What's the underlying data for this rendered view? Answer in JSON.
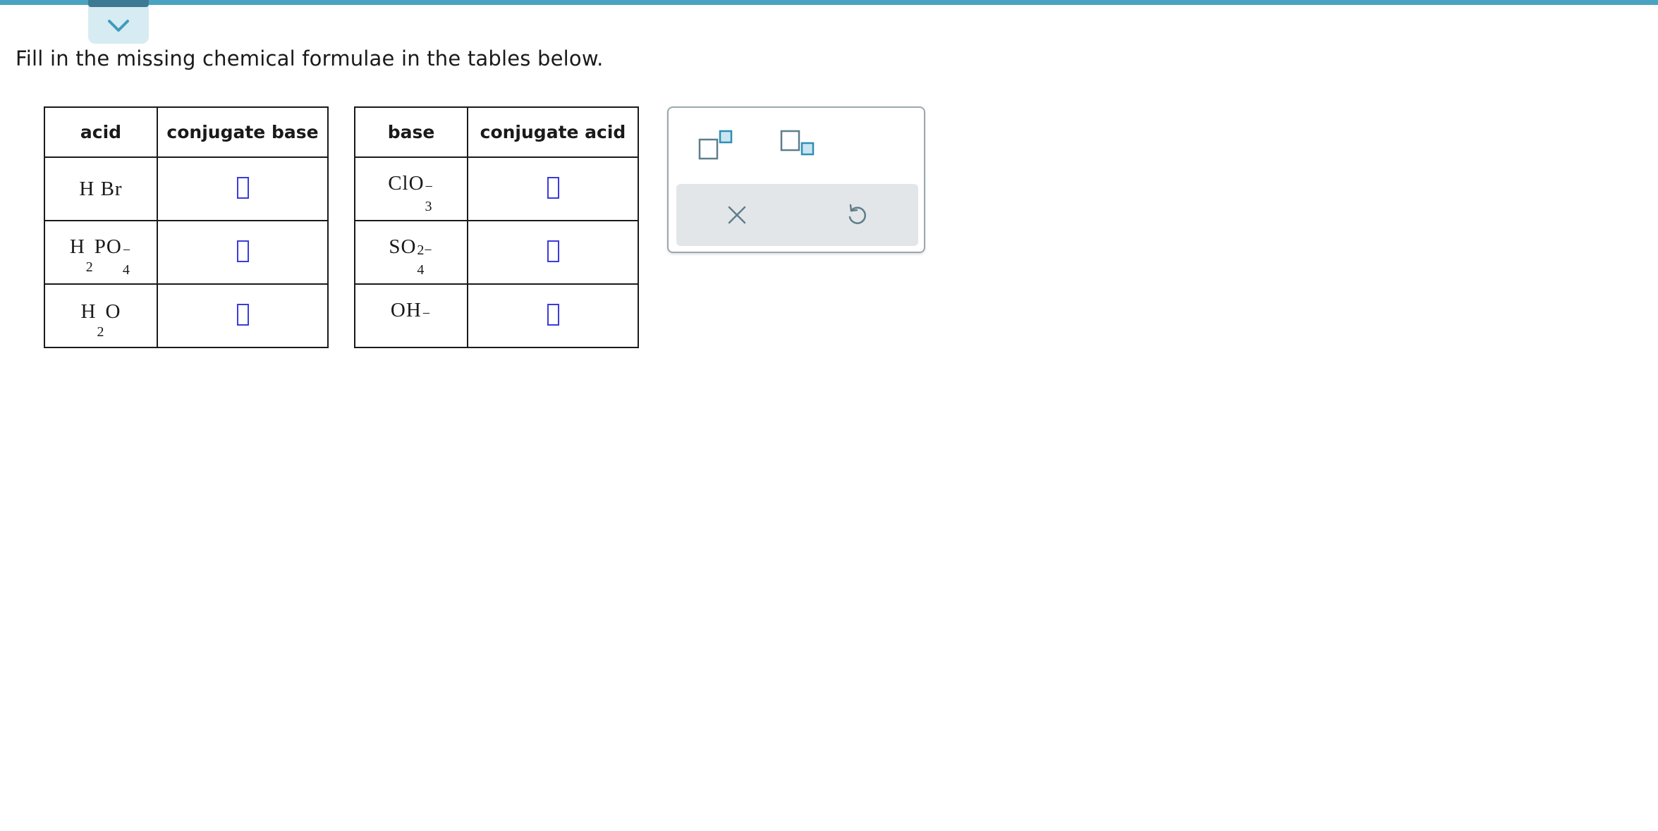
{
  "instruction": "Fill in the missing chemical formulae in the tables below.",
  "table_left": {
    "headers": [
      "acid",
      "conjugate base"
    ],
    "rows": [
      {
        "acid": {
          "parts": [
            {
              "el": "H Br",
              "sub": "",
              "sup": ""
            }
          ]
        }
      },
      {
        "acid": {
          "parts": [
            {
              "el": "H",
              "sub": "2",
              "sup": ""
            },
            {
              "el": "PO",
              "sub": "4",
              "sup": "−"
            }
          ]
        }
      },
      {
        "acid": {
          "parts": [
            {
              "el": "H",
              "sub": "2",
              "sup": ""
            },
            {
              "el": "O",
              "sub": "",
              "sup": ""
            }
          ]
        }
      }
    ]
  },
  "table_right": {
    "headers": [
      "base",
      "conjugate acid"
    ],
    "rows": [
      {
        "base": {
          "parts": [
            {
              "el": "ClO",
              "sub": "3",
              "sup": "−"
            }
          ]
        }
      },
      {
        "base": {
          "parts": [
            {
              "el": "SO",
              "sub": "4",
              "sup": "2−"
            }
          ]
        }
      },
      {
        "base": {
          "parts": [
            {
              "el": "OH",
              "sub": "",
              "sup": "−"
            }
          ]
        }
      }
    ]
  },
  "palette": {
    "superscript_icon": "superscript-template-icon",
    "subscript_icon": "subscript-template-icon",
    "clear_icon": "close-icon",
    "undo_icon": "undo-icon"
  },
  "colors": {
    "accent": "#4aa3c0",
    "answer_box": "#3b3bdb",
    "palette_icon": "#5f7d8c"
  }
}
